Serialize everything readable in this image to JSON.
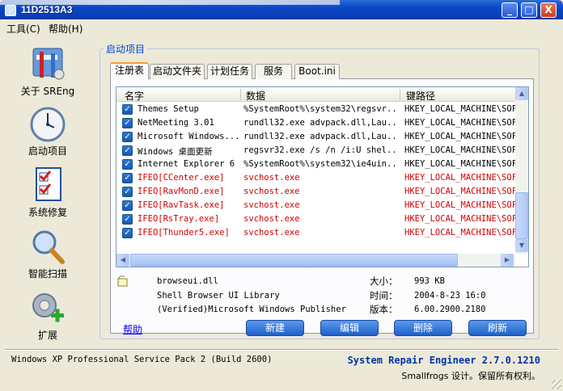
{
  "window": {
    "title": "11D2513A3",
    "controls": [
      "_",
      "□",
      "X"
    ]
  },
  "menu": [
    {
      "label": "工具(C)"
    },
    {
      "label": "帮助(H)"
    }
  ],
  "sidebar": [
    {
      "label": "关于 SREng",
      "icon": "tools-icon"
    },
    {
      "label": "启动项目",
      "icon": "clock-icon"
    },
    {
      "label": "系统修复",
      "icon": "checklist-icon"
    },
    {
      "label": "智能扫描",
      "icon": "magnifier-icon"
    },
    {
      "label": "扩展",
      "icon": "gear-plus-icon"
    }
  ],
  "group_title": "启动项目",
  "tabs": [
    "注册表",
    "启动文件夹",
    "计划任务",
    "服务",
    "Boot.ini"
  ],
  "active_tab": 0,
  "columns": [
    "名字",
    "数据",
    "键路径"
  ],
  "rows": [
    {
      "name": "Themes Setup",
      "data": "%SystemRoot%\\system32\\regsvr...",
      "key": "HKEY_LOCAL_MACHINE\\SOF",
      "red": false
    },
    {
      "name": "NetMeeting 3.01",
      "data": "rundll32.exe advpack.dll,Lau...",
      "key": "HKEY_LOCAL_MACHINE\\SOF",
      "red": false
    },
    {
      "name": "Microsoft Windows...",
      "data": "rundll32.exe advpack.dll,Lau...",
      "key": "HKEY_LOCAL_MACHINE\\SOF",
      "red": false
    },
    {
      "name": "Windows 桌面更新",
      "data": "regsvr32.exe /s /n /i:U shel...",
      "key": "HKEY_LOCAL_MACHINE\\SOF",
      "red": false
    },
    {
      "name": "Internet Explorer 6",
      "data": "%SystemRoot%\\system32\\ie4uin...",
      "key": "HKEY_LOCAL_MACHINE\\SOF",
      "red": false
    },
    {
      "name": "IFEO[CCenter.exe]",
      "data": "svchost.exe",
      "key": "HKEY_LOCAL_MACHINE\\SOF",
      "red": true
    },
    {
      "name": "IFEO[RavMonD.exe]",
      "data": "svchost.exe",
      "key": "HKEY_LOCAL_MACHINE\\SOF",
      "red": true
    },
    {
      "name": "IFEO[RavTask.exe]",
      "data": "svchost.exe",
      "key": "HKEY_LOCAL_MACHINE\\SOF",
      "red": true
    },
    {
      "name": "IFEO[RsTray.exe]",
      "data": "svchost.exe",
      "key": "HKEY_LOCAL_MACHINE\\SOF",
      "red": true
    },
    {
      "name": "IFEO[Thunder5.exe]",
      "data": "svchost.exe",
      "key": "HKEY_LOCAL_MACHINE\\SOF",
      "red": true
    }
  ],
  "file_info": {
    "filename": "browseui.dll",
    "description": "Shell Browser UI Library",
    "publisher": "(Verified)Microsoft Windows Publisher",
    "size_label": "大小：",
    "size": "993 KB",
    "time_label": "时间：",
    "time": "2004-8-23 16:0",
    "version_label": "版本：",
    "version": "6.00.2900.2180"
  },
  "help_link": "帮助",
  "buttons": [
    "新建",
    "编辑",
    "删除",
    "刷新"
  ],
  "status": {
    "os": "Windows XP Professional Service Pack 2 (Build 2600)",
    "product": "System Repair Engineer 2.7.0.1210",
    "copyright": "Smallfrogs 设计。保留所有权利。"
  },
  "colors": {
    "titlebar": "#0a46c8",
    "red_item": "#d00000",
    "link": "#0000ff",
    "product": "#0033aa"
  }
}
